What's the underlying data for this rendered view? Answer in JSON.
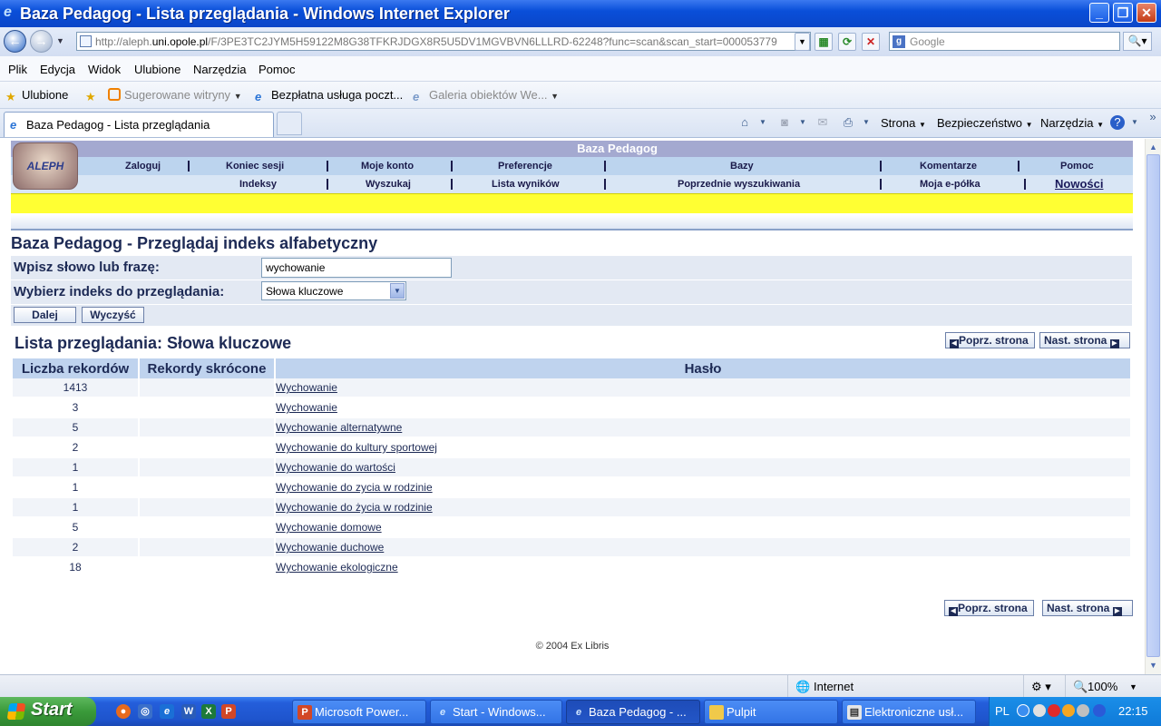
{
  "window": {
    "title": "Baza Pedagog - Lista przeglądania - Windows Internet Explorer"
  },
  "address": {
    "url_prefix": "http://aleph.",
    "url_domain": "uni.opole.pl",
    "url_rest": "/F/3PE3TC2JYM5H59122M8G38TFKRJDGX8R5U5DV1MGVBVN6LLLRD-62248?func=scan&scan_start=000053779",
    "search_placeholder": "Google"
  },
  "menu": [
    "Plik",
    "Edycja",
    "Widok",
    "Ulubione",
    "Narzędzia",
    "Pomoc"
  ],
  "favorites": {
    "label": "Ulubione",
    "items": [
      "Sugerowane witryny",
      "Bezpłatna usługa poczt...",
      "Galeria obiektów We..."
    ]
  },
  "tab": {
    "title": "Baza Pedagog - Lista przeglądania"
  },
  "commands": {
    "page": "Strona",
    "safety": "Bezpieczeństwo",
    "tools": "Narzędzia"
  },
  "aleph": {
    "logo": "ALEPH",
    "db_title": "Baza Pedagog",
    "nav_row1": [
      "Zaloguj",
      "Koniec sesji",
      "Moje konto",
      "Preferencje",
      "Bazy",
      "Komentarze",
      "Pomoc"
    ],
    "nav_row2": [
      "Indeksy",
      "Wyszukaj",
      "Lista wyników",
      "Poprzednie wyszukiwania",
      "Moja e-półka",
      "Nowości"
    ]
  },
  "page": {
    "heading": "Baza Pedagog - Przeglądaj indeks alfabetyczny",
    "phrase_label": "Wpisz słowo lub frazę:",
    "phrase_value": "wychowanie",
    "index_label": "Wybierz indeks do przeglądania:",
    "index_value": "Słowa kluczowe",
    "btn_go": "Dalej",
    "btn_clear": "Wyczyść",
    "list_heading": "Lista przeglądania: Słowa kluczowe",
    "prev": "Poprz. strona",
    "next": "Nast. strona",
    "footer": "© 2004 Ex Libris"
  },
  "table": {
    "headers": [
      "Liczba rekordów",
      "Rekordy skrócone",
      "Hasło"
    ],
    "rows": [
      {
        "count": "1413",
        "term": "Wychowanie"
      },
      {
        "count": "3",
        "term": "Wychowanie"
      },
      {
        "count": "5",
        "term": "Wychowanie alternatywne"
      },
      {
        "count": "2",
        "term": "Wychowanie do kultury sportowej"
      },
      {
        "count": "1",
        "term": "Wychowanie do wartości"
      },
      {
        "count": "1",
        "term": "Wychowanie do zycia w rodzinie"
      },
      {
        "count": "1",
        "term": "Wychowanie do życia w rodzinie"
      },
      {
        "count": "5",
        "term": "Wychowanie domowe"
      },
      {
        "count": "2",
        "term": "Wychowanie duchowe"
      },
      {
        "count": "18",
        "term": "Wychowanie ekologiczne"
      }
    ]
  },
  "status": {
    "zone": "Internet",
    "zoom": "100%"
  },
  "taskbar": {
    "start": "Start",
    "tasks": [
      "Microsoft Power...",
      "Start - Windows...",
      "Baza Pedagog - ...",
      "Pulpit",
      "Elektroniczne usł..."
    ],
    "lang": "PL",
    "clock": "22:15"
  }
}
